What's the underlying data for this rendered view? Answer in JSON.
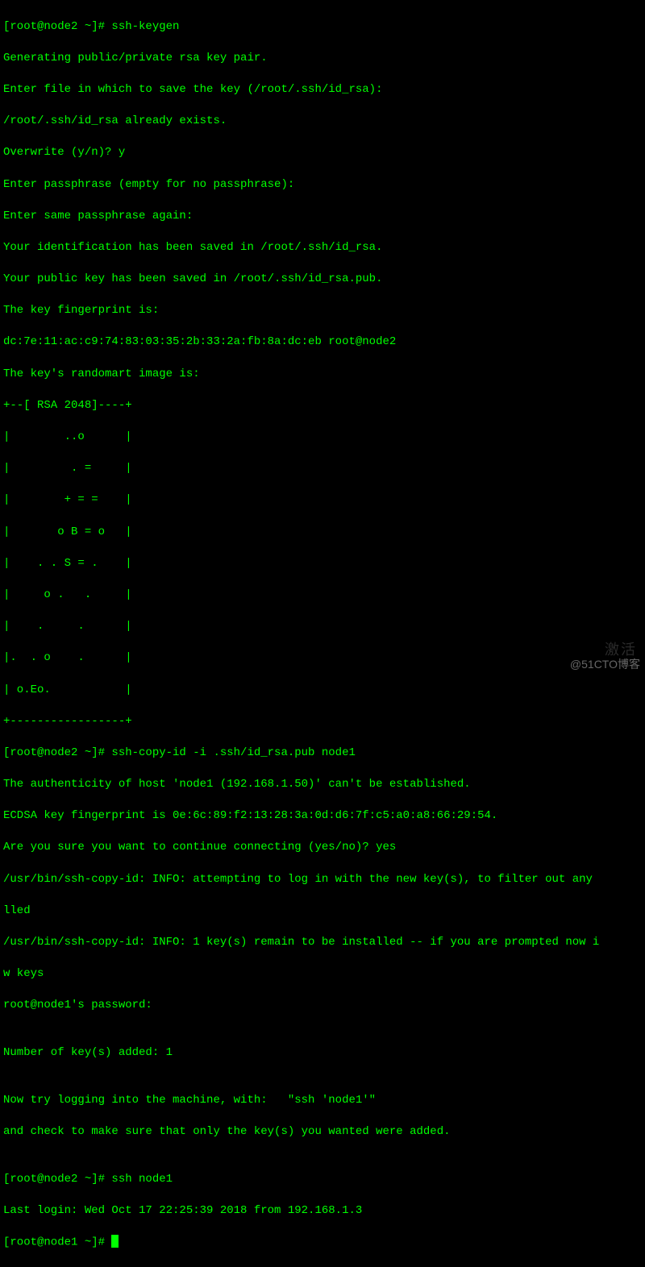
{
  "terminal": {
    "lines": [
      "[root@node2 ~]# ssh-keygen",
      "Generating public/private rsa key pair.",
      "Enter file in which to save the key (/root/.ssh/id_rsa):",
      "/root/.ssh/id_rsa already exists.",
      "Overwrite (y/n)? y",
      "Enter passphrase (empty for no passphrase):",
      "Enter same passphrase again:",
      "Your identification has been saved in /root/.ssh/id_rsa.",
      "Your public key has been saved in /root/.ssh/id_rsa.pub.",
      "The key fingerprint is:",
      "dc:7e:11:ac:c9:74:83:03:35:2b:33:2a:fb:8a:dc:eb root@node2",
      "The key's randomart image is:",
      "+--[ RSA 2048]----+",
      "|        ..o      |",
      "|         . =     |",
      "|        + = =    |",
      "|       o B = o   |",
      "|    . . S = .    |",
      "|     o .   .     |",
      "|    .     .      |",
      "|.  . o    .      |",
      "| o.Eo.           |",
      "+-----------------+",
      "[root@node2 ~]# ssh-copy-id -i .ssh/id_rsa.pub node1",
      "The authenticity of host 'node1 (192.168.1.50)' can't be established.",
      "ECDSA key fingerprint is 0e:6c:89:f2:13:28:3a:0d:d6:7f:c5:a0:a8:66:29:54.",
      "Are you sure you want to continue connecting (yes/no)? yes",
      "/usr/bin/ssh-copy-id: INFO: attempting to log in with the new key(s), to filter out any",
      "lled",
      "/usr/bin/ssh-copy-id: INFO: 1 key(s) remain to be installed -- if you are prompted now i",
      "w keys",
      "root@node1's password:",
      "",
      "Number of key(s) added: 1",
      "",
      "Now try logging into the machine, with:   \"ssh 'node1'\"",
      "and check to make sure that only the key(s) you wanted were added.",
      "",
      "[root@node2 ~]# ssh node1",
      "Last login: Wed Oct 17 22:25:39 2018 from 192.168.1.3",
      "[root@node1 ~]# "
    ]
  },
  "watermark": {
    "text": "@51CTO博客",
    "faint": "激活"
  }
}
